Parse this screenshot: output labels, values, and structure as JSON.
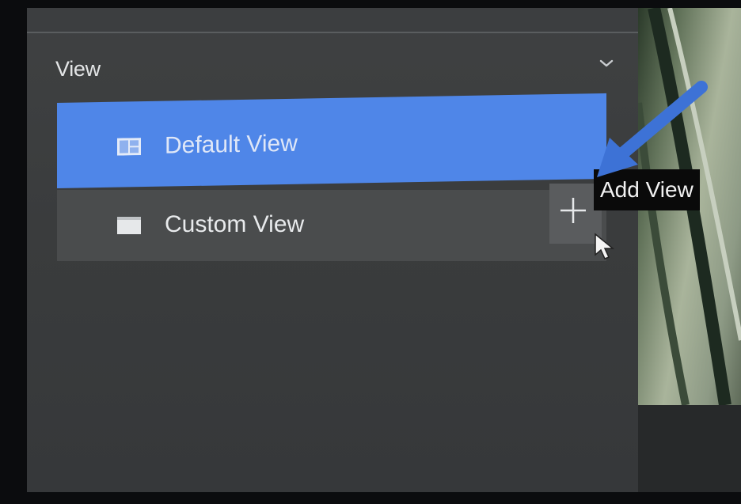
{
  "panel": {
    "section_title": "View",
    "items": [
      {
        "label": "Default View",
        "selected": true
      },
      {
        "label": "Custom View",
        "selected": false
      }
    ]
  },
  "tooltip": {
    "text": "Add View"
  },
  "icons": {
    "collapse": "chevron-down-icon",
    "default_view": "layout-grid-icon",
    "custom_view": "folder-icon",
    "add": "plus-icon",
    "cursor": "mouse-pointer-icon",
    "annotation": "arrow-annotation-icon"
  },
  "colors": {
    "selected_item": "#4f86e8",
    "panel_bg": "#3c3e40",
    "annotation_arrow": "#3d72d6",
    "tooltip_bg": "#0a0a0a"
  }
}
